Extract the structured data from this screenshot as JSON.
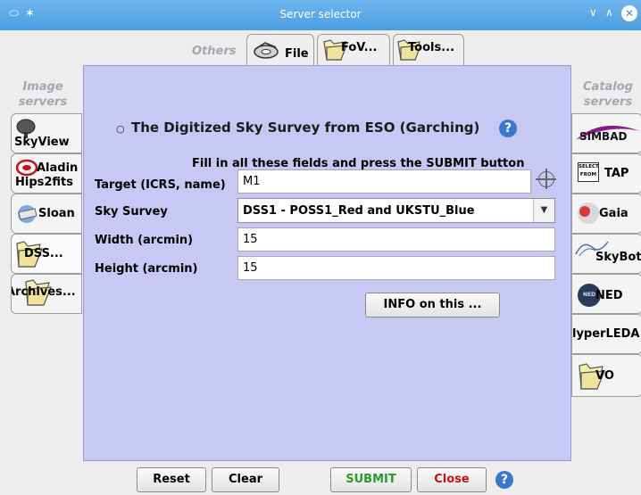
{
  "window": {
    "title": "Server selector"
  },
  "tabs": {
    "others_label": "Others",
    "items": [
      {
        "label": "File",
        "icon": "disk-icon"
      },
      {
        "label": "FoV...",
        "icon": "folder-icon"
      },
      {
        "label": "Tools...",
        "icon": "folder-icon"
      }
    ]
  },
  "left": {
    "header": "Image servers",
    "items": [
      {
        "label": "SkyView",
        "icon": "skyview-dish-icon"
      },
      {
        "label": "Aladin Hips2fits",
        "label_line1": "Aladin",
        "label_line2": "Hips2fits",
        "icon": "aladin-icon"
      },
      {
        "label": "Sloan",
        "icon": "sloan-icon"
      },
      {
        "label": "DSS...",
        "icon": "folder-icon",
        "selected": true
      },
      {
        "label": "Archives...",
        "icon": "folder-icon"
      }
    ]
  },
  "right": {
    "header": "Catalog servers",
    "items": [
      {
        "label": "SIMBAD",
        "icon": "simbad-logo-icon"
      },
      {
        "label": "TAP",
        "icon": "select-from-icon",
        "icon_text": "SELECT FROM"
      },
      {
        "label": "Gaia",
        "icon": "gaia-icon"
      },
      {
        "label": "SkyBot",
        "icon": "skybot-icon"
      },
      {
        "label": "NED",
        "icon": "ned-icon",
        "icon_text": "NED"
      },
      {
        "label": "HyperLEDA",
        "display": "lyperLEDA"
      },
      {
        "label": "VO",
        "icon": "folder-icon"
      }
    ]
  },
  "panel": {
    "server_title": "The Digitized Sky Survey from ESO (Garching)",
    "instructions": "Fill in all these fields and press the SUBMIT button",
    "fields": {
      "target": {
        "label": "Target (ICRS, name)",
        "value": "M1"
      },
      "survey": {
        "label": "Sky Survey",
        "value": "DSS1 - POSS1_Red and UKSTU_Blue"
      },
      "width": {
        "label": "Width (arcmin)",
        "value": "15"
      },
      "height": {
        "label": "Height (arcmin)",
        "value": "15"
      }
    },
    "info_button": "INFO on this ..."
  },
  "buttons": {
    "reset": "Reset",
    "clear": "Clear",
    "submit": "SUBMIT",
    "close": "Close"
  },
  "colors": {
    "titlebar": "#4c9ee0",
    "panel_bg": "#c8c8f5",
    "submit_text": "#2a9a2a",
    "close_text": "#d01010",
    "help": "#3a78c9"
  }
}
